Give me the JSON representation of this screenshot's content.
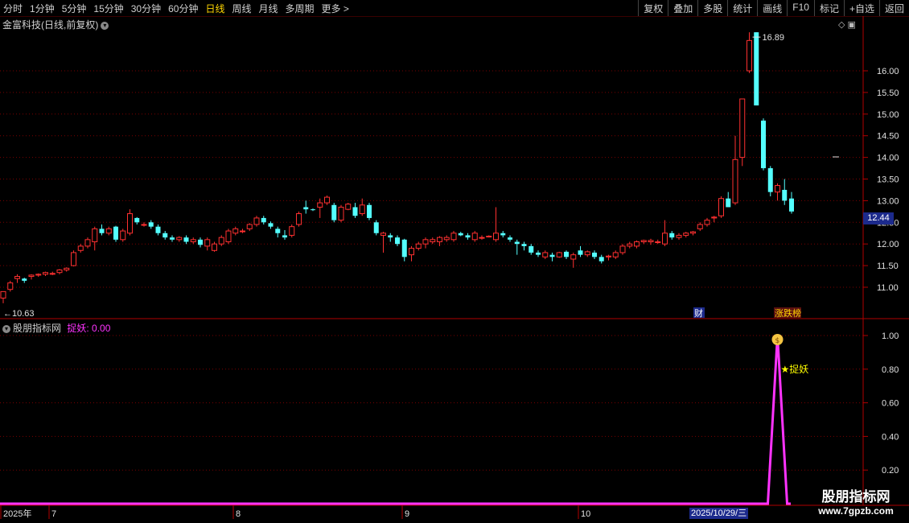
{
  "toolbar": {
    "periods": [
      "分时",
      "1分钟",
      "5分钟",
      "15分钟",
      "30分钟",
      "60分钟",
      "日线",
      "周线",
      "月线",
      "多周期",
      "更多 >"
    ],
    "active_period": "日线",
    "right_buttons": [
      "复权",
      "叠加",
      "多股",
      "统计",
      "画线",
      "F10",
      "标记",
      "+自选",
      "返回"
    ]
  },
  "main_chart": {
    "title": "金富科技(日线,前复权)",
    "high_label": "16.89",
    "low_label": "10.63",
    "current_price": "12.44",
    "y_ticks": [
      "16.00",
      "15.50",
      "15.00",
      "14.50",
      "14.00",
      "13.50",
      "13.00",
      "12.50",
      "12.00",
      "11.50",
      "11.00"
    ],
    "badge_cai": "财",
    "badge_zdb": "涨跌榜"
  },
  "indicator": {
    "title": "股朋指标网",
    "name": "捉妖",
    "value": "0.00",
    "y_ticks": [
      "1.00",
      "0.80",
      "0.60",
      "0.40",
      "0.20"
    ],
    "signal_label": "★捉妖"
  },
  "x_axis": {
    "labels": [
      "2025年",
      "7",
      "8",
      "9",
      "10"
    ],
    "cursor_date": "2025/10/29/三"
  },
  "watermark": {
    "line1": "股朋指标网",
    "line2": "www.7gpzb.com"
  },
  "colors": {
    "up": "#ff3030",
    "down": "#54ffff",
    "indicator_line": "#ff33ff",
    "grid": "#7a0000",
    "active": "#ffd700"
  },
  "chart_data": {
    "type": "candlestick",
    "title": "金富科技(日线,前复权)",
    "ylim": [
      10.63,
      16.89
    ],
    "x_months": [
      "2025年",
      "7",
      "8",
      "9",
      "10"
    ],
    "ohlc": [
      [
        10.75,
        10.9,
        10.63,
        10.9
      ],
      [
        10.95,
        11.15,
        10.9,
        11.1
      ],
      [
        11.2,
        11.3,
        11.1,
        11.25
      ],
      [
        11.2,
        11.22,
        11.1,
        11.15
      ],
      [
        11.25,
        11.3,
        11.18,
        11.28
      ],
      [
        11.28,
        11.32,
        11.24,
        11.3
      ],
      [
        11.3,
        11.36,
        11.26,
        11.34
      ],
      [
        11.3,
        11.36,
        11.28,
        11.32
      ],
      [
        11.34,
        11.42,
        11.3,
        11.4
      ],
      [
        11.4,
        11.46,
        11.36,
        11.44
      ],
      [
        11.5,
        11.85,
        11.48,
        11.8
      ],
      [
        11.85,
        12.0,
        11.8,
        11.95
      ],
      [
        11.95,
        12.15,
        11.9,
        12.1
      ],
      [
        12.05,
        12.4,
        11.85,
        12.35
      ],
      [
        12.35,
        12.45,
        12.2,
        12.25
      ],
      [
        12.25,
        12.4,
        12.2,
        12.35
      ],
      [
        12.4,
        12.42,
        12.05,
        12.1
      ],
      [
        12.1,
        12.35,
        12.05,
        12.3
      ],
      [
        12.25,
        12.8,
        12.2,
        12.7
      ],
      [
        12.6,
        12.62,
        12.45,
        12.5
      ],
      [
        12.45,
        12.5,
        12.4,
        12.45
      ],
      [
        12.5,
        12.55,
        12.35,
        12.4
      ],
      [
        12.4,
        12.45,
        12.2,
        12.25
      ],
      [
        12.25,
        12.3,
        12.1,
        12.15
      ],
      [
        12.15,
        12.2,
        12.05,
        12.1
      ],
      [
        12.1,
        12.18,
        12.05,
        12.15
      ],
      [
        12.15,
        12.2,
        12.0,
        12.05
      ],
      [
        12.05,
        12.15,
        12.0,
        12.1
      ],
      [
        12.1,
        12.15,
        11.92,
        11.98
      ],
      [
        11.95,
        12.15,
        11.85,
        12.1
      ],
      [
        11.85,
        12.05,
        11.82,
        12.0
      ],
      [
        12.0,
        12.2,
        11.95,
        12.15
      ],
      [
        12.05,
        12.35,
        12.0,
        12.3
      ],
      [
        12.25,
        12.4,
        12.2,
        12.35
      ],
      [
        12.3,
        12.35,
        12.25,
        12.3
      ],
      [
        12.35,
        12.48,
        12.3,
        12.45
      ],
      [
        12.45,
        12.65,
        12.4,
        12.6
      ],
      [
        12.6,
        12.65,
        12.45,
        12.5
      ],
      [
        12.48,
        12.52,
        12.35,
        12.4
      ],
      [
        12.35,
        12.4,
        12.15,
        12.25
      ],
      [
        12.2,
        12.32,
        12.1,
        12.15
      ],
      [
        12.2,
        12.45,
        12.15,
        12.4
      ],
      [
        12.45,
        12.75,
        12.4,
        12.7
      ],
      [
        12.85,
        13.0,
        12.7,
        12.8
      ],
      [
        12.8,
        12.82,
        12.76,
        12.79
      ],
      [
        12.85,
        13.05,
        12.6,
        12.95
      ],
      [
        12.95,
        13.12,
        12.9,
        13.08
      ],
      [
        12.9,
        12.95,
        12.5,
        12.55
      ],
      [
        12.55,
        12.9,
        12.5,
        12.85
      ],
      [
        12.8,
        12.95,
        12.78,
        12.92
      ],
      [
        12.85,
        12.95,
        12.6,
        12.65
      ],
      [
        12.7,
        13.05,
        12.65,
        12.9
      ],
      [
        12.9,
        12.95,
        12.55,
        12.6
      ],
      [
        12.5,
        12.55,
        12.2,
        12.25
      ],
      [
        12.2,
        12.28,
        11.8,
        12.25
      ],
      [
        12.2,
        12.25,
        12.05,
        12.15
      ],
      [
        12.15,
        12.2,
        11.95,
        12.0
      ],
      [
        12.1,
        12.12,
        11.6,
        11.7
      ],
      [
        11.75,
        11.95,
        11.6,
        11.9
      ],
      [
        11.9,
        12.05,
        11.85,
        12.0
      ],
      [
        12.0,
        12.15,
        11.9,
        12.1
      ],
      [
        12.05,
        12.15,
        12.0,
        12.1
      ],
      [
        12.05,
        12.18,
        11.95,
        12.15
      ],
      [
        12.1,
        12.2,
        12.05,
        12.15
      ],
      [
        12.1,
        12.3,
        12.05,
        12.25
      ],
      [
        12.25,
        12.28,
        12.18,
        12.2
      ],
      [
        12.2,
        12.25,
        12.1,
        12.15
      ],
      [
        12.1,
        12.3,
        12.05,
        12.25
      ],
      [
        12.15,
        12.2,
        12.1,
        12.15
      ],
      [
        12.18,
        12.2,
        12.15,
        12.18
      ],
      [
        12.1,
        12.85,
        12.05,
        12.25
      ],
      [
        12.25,
        12.3,
        12.15,
        12.2
      ],
      [
        12.15,
        12.2,
        12.05,
        12.1
      ],
      [
        12.05,
        12.1,
        11.75,
        12.0
      ],
      [
        12.0,
        12.05,
        11.85,
        11.95
      ],
      [
        11.95,
        12.0,
        11.75,
        11.8
      ],
      [
        11.8,
        11.85,
        11.7,
        11.75
      ],
      [
        11.7,
        11.85,
        11.65,
        11.8
      ],
      [
        11.75,
        11.8,
        11.6,
        11.7
      ],
      [
        11.7,
        11.82,
        11.68,
        11.8
      ],
      [
        11.82,
        11.85,
        11.65,
        11.7
      ],
      [
        11.65,
        11.8,
        11.45,
        11.75
      ],
      [
        11.85,
        11.95,
        11.7,
        11.75
      ],
      [
        11.75,
        11.85,
        11.7,
        11.82
      ],
      [
        11.8,
        11.85,
        11.65,
        11.7
      ],
      [
        11.7,
        11.75,
        11.55,
        11.6
      ],
      [
        11.7,
        11.75,
        11.62,
        11.72
      ],
      [
        11.7,
        11.85,
        11.65,
        11.8
      ],
      [
        11.8,
        12.0,
        11.75,
        11.95
      ],
      [
        11.95,
        12.05,
        11.9,
        12.0
      ],
      [
        11.95,
        12.08,
        11.9,
        12.05
      ],
      [
        12.05,
        12.1,
        12.0,
        12.08
      ],
      [
        12.05,
        12.12,
        11.98,
        12.08
      ],
      [
        12.05,
        12.1,
        12.0,
        12.05
      ],
      [
        12.0,
        12.55,
        11.95,
        12.25
      ],
      [
        12.25,
        12.3,
        12.1,
        12.15
      ],
      [
        12.15,
        12.25,
        12.1,
        12.2
      ],
      [
        12.2,
        12.28,
        12.15,
        12.25
      ],
      [
        12.25,
        12.3,
        12.2,
        12.28
      ],
      [
        12.35,
        12.5,
        12.3,
        12.45
      ],
      [
        12.45,
        12.6,
        12.4,
        12.55
      ],
      [
        12.6,
        12.65,
        12.5,
        12.62
      ],
      [
        12.65,
        13.1,
        12.6,
        13.05
      ],
      [
        13.05,
        13.2,
        12.85,
        12.85
      ],
      [
        12.95,
        14.5,
        12.9,
        13.95
      ],
      [
        14.0,
        15.35,
        13.8,
        15.35
      ],
      [
        16.0,
        16.89,
        15.95,
        16.7
      ],
      [
        16.89,
        16.89,
        15.2,
        15.2
      ],
      [
        14.85,
        14.9,
        13.7,
        13.75
      ],
      [
        13.75,
        13.8,
        13.1,
        13.2
      ],
      [
        13.2,
        13.4,
        13.0,
        13.35
      ],
      [
        13.25,
        13.5,
        12.9,
        13.0
      ],
      [
        13.05,
        13.2,
        12.7,
        12.75
      ]
    ],
    "indicator": {
      "name": "捉妖",
      "ylim": [
        0,
        1
      ],
      "signal_index": 110,
      "signal_value": 1.0
    }
  }
}
